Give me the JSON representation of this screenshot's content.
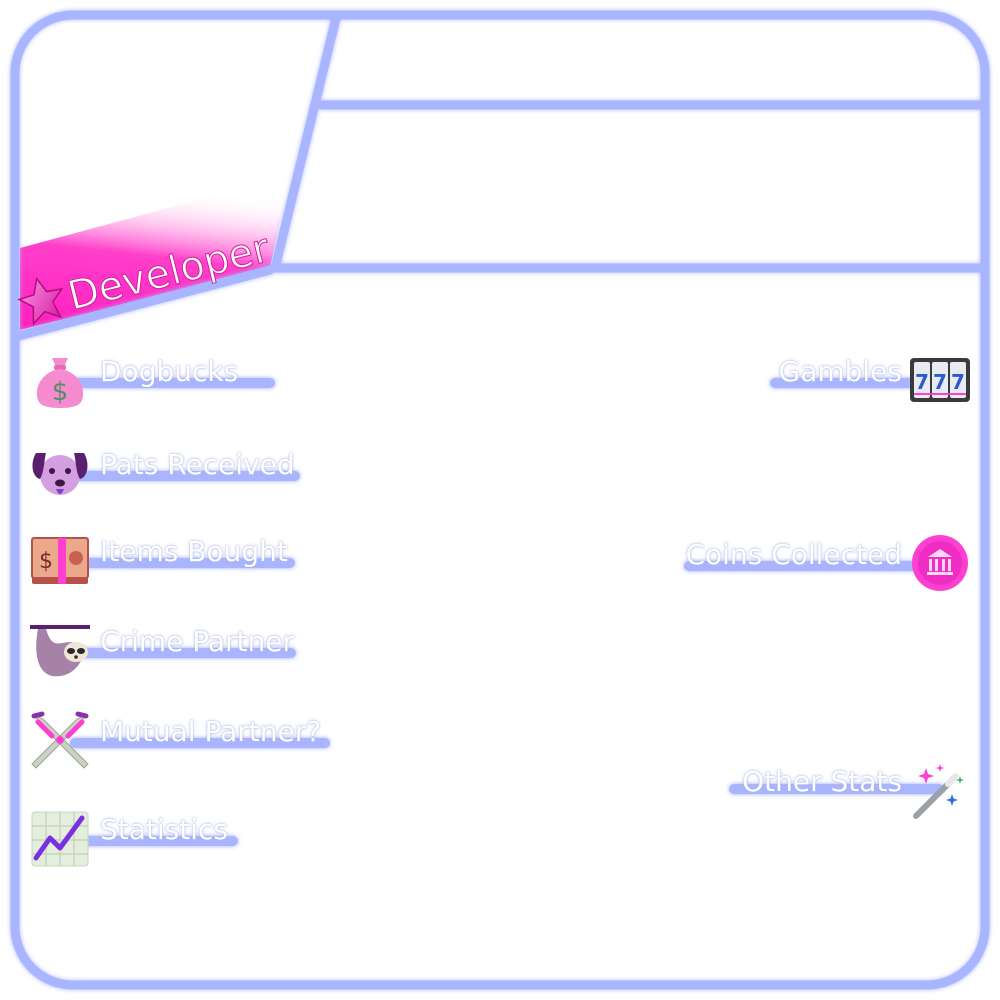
{
  "badge": {
    "label": "Developer"
  },
  "colors": {
    "frame": "#a9b5ff",
    "badge": "#ff1fbf",
    "accent": "#e33cf0"
  },
  "left_stats": [
    {
      "label": "Dogbucks",
      "icon": "money-bag-icon"
    },
    {
      "label": "Pats Received",
      "icon": "dog-face-icon"
    },
    {
      "label": "Items Bought",
      "icon": "banknote-icon"
    },
    {
      "label": "Crime Partner",
      "icon": "sloth-icon"
    },
    {
      "label": "Mutual Partner?",
      "icon": "crossed-swords-icon"
    },
    {
      "label": "Statistics",
      "icon": "chart-increasing-icon"
    }
  ],
  "right_stats": [
    {
      "label": "Gambles",
      "icon": "slot-machine-icon"
    },
    {
      "label": "Coins Collected",
      "icon": "coin-icon"
    },
    {
      "label": "Other Stats",
      "icon": "magic-wand-icon"
    }
  ]
}
